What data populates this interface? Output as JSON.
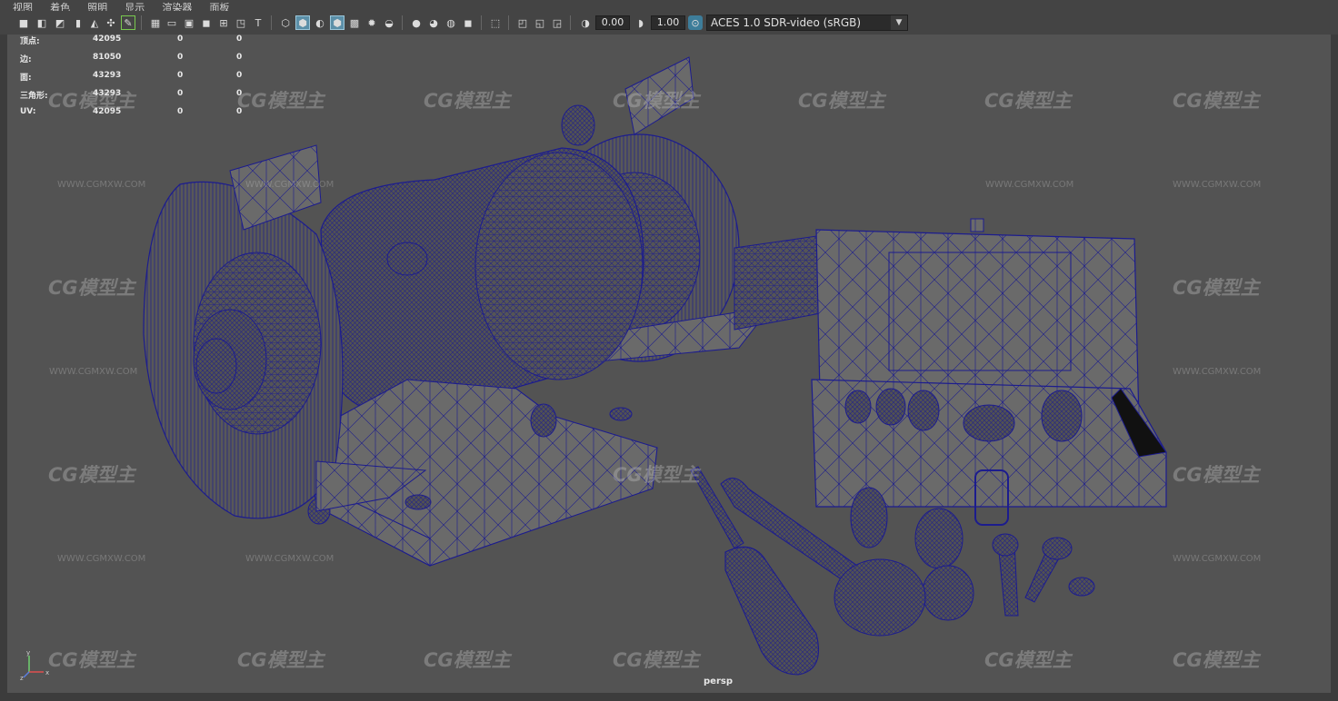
{
  "menu": {
    "items": [
      "视图",
      "着色",
      "照明",
      "显示",
      "渲染器",
      "面板"
    ]
  },
  "toolbar": {
    "exposure_value": "0.00",
    "gamma_value": "1.00",
    "colorspace": "ACES 1.0 SDR-video (sRGB)",
    "icons": [
      "camera-select-icon",
      "camera-attributes-icon",
      "bookmark-icon",
      "image-plane-icon",
      "grease-pencil-icon",
      "2d-pan-zoom-icon",
      "grid-icon",
      "film-gate-icon",
      "resolution-gate-icon",
      "gate-mask-icon",
      "field-chart-icon",
      "safe-action-icon",
      "safe-title-icon",
      "wireframe-icon",
      "smooth-shade-icon",
      "default-material-icon",
      "wireframe-on-shaded-icon",
      "textured-icon",
      "use-all-lights-icon",
      "shadows-icon",
      "screen-space-ao-icon",
      "motion-blur-icon",
      "multisample-aa-icon",
      "depth-of-field-icon",
      "isolate-select-icon",
      "xray-icon",
      "xray-joints-icon",
      "xray-components-icon",
      "exposure-icon",
      "gamma-icon",
      "color-management-icon"
    ]
  },
  "hud": {
    "rows": [
      {
        "label": "顶点:",
        "v1": "42095",
        "v2": "0",
        "v3": "0"
      },
      {
        "label": "边:",
        "v1": "81050",
        "v2": "0",
        "v3": "0"
      },
      {
        "label": "面:",
        "v1": "43293",
        "v2": "0",
        "v3": "0"
      },
      {
        "label": "三角形:",
        "v1": "43293",
        "v2": "0",
        "v3": "0"
      },
      {
        "label": "UV:",
        "v1": "42095",
        "v2": "0",
        "v3": "0"
      }
    ]
  },
  "viewport": {
    "camera": "persp",
    "background_color": "#535353",
    "wire_color": "#1a1a8c"
  },
  "watermark": {
    "logo_text": "CG模型主",
    "url_text": "WWW.CGMXW.COM"
  },
  "axis": {
    "x": "x",
    "y": "y",
    "z": "z"
  }
}
